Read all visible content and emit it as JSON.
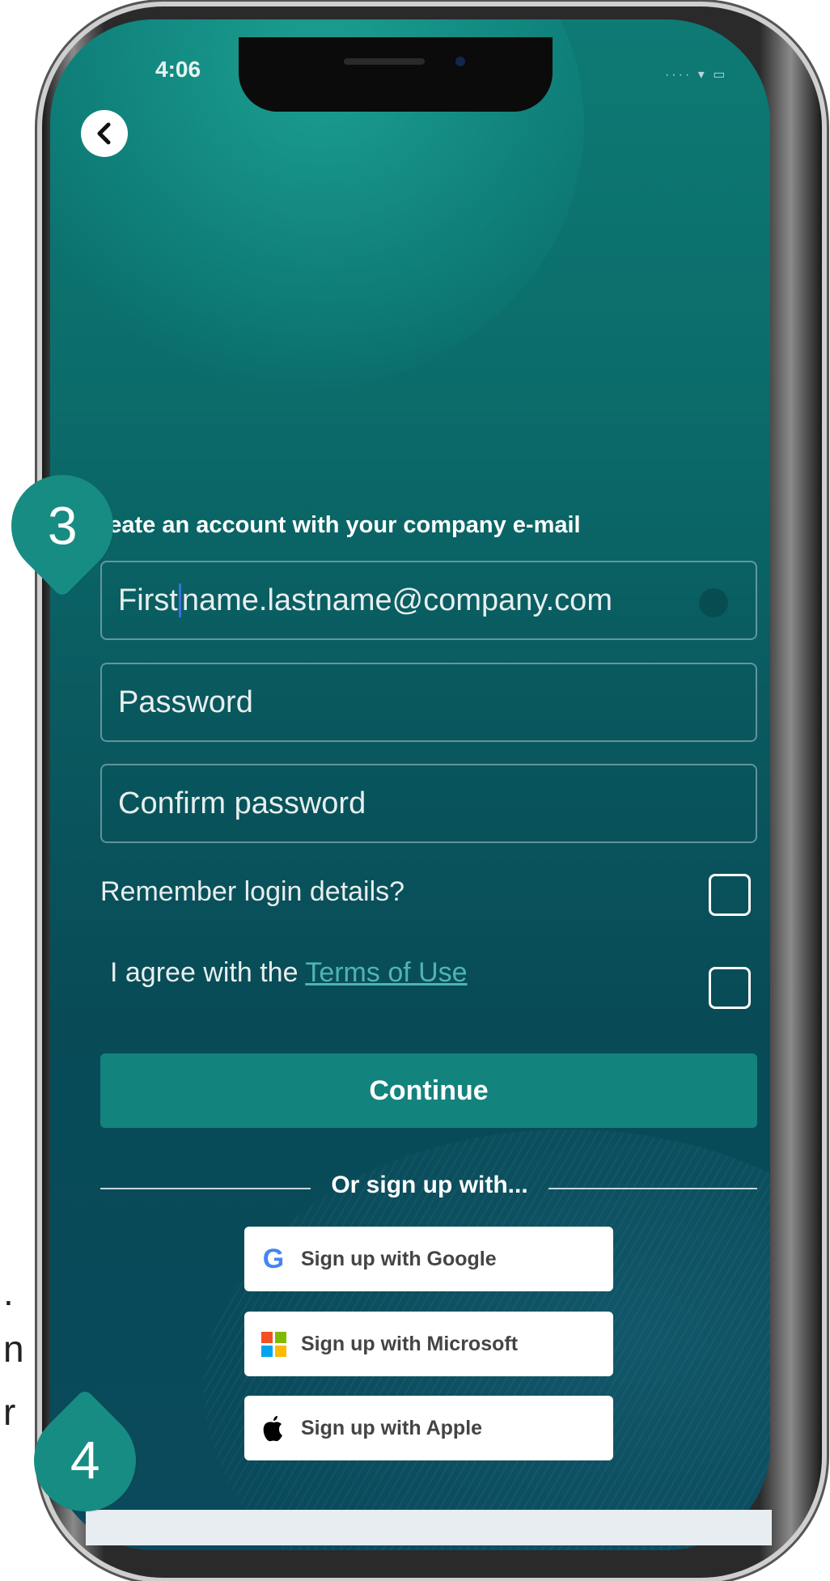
{
  "status_bar": {
    "time": "4:06",
    "indicators": "···· ▾ ▭"
  },
  "back_icon": "chevron-left-icon",
  "form": {
    "heading": "Create an account with your company e-mail",
    "email_value_before_cursor": "First",
    "email_value_after_cursor": "name.lastname@company.com",
    "password_placeholder": "Password",
    "confirm_password_placeholder": "Confirm password",
    "remember_label": "Remember login details?",
    "agree_label": "I agree with the ",
    "terms_link": "Terms of Use",
    "continue_label": "Continue"
  },
  "social": {
    "divider_text": "Or sign up with...",
    "google_label": "Sign up with Google",
    "microsoft_label": "Sign up with Microsoft",
    "apple_label": "Sign up with Apple"
  },
  "steps": {
    "step3": "3",
    "step4": "4"
  },
  "margin_fragments": [
    ".",
    "n",
    "r"
  ],
  "colors": {
    "accent": "#13837d",
    "badge": "#178c83",
    "link": "#4fb5b0"
  }
}
